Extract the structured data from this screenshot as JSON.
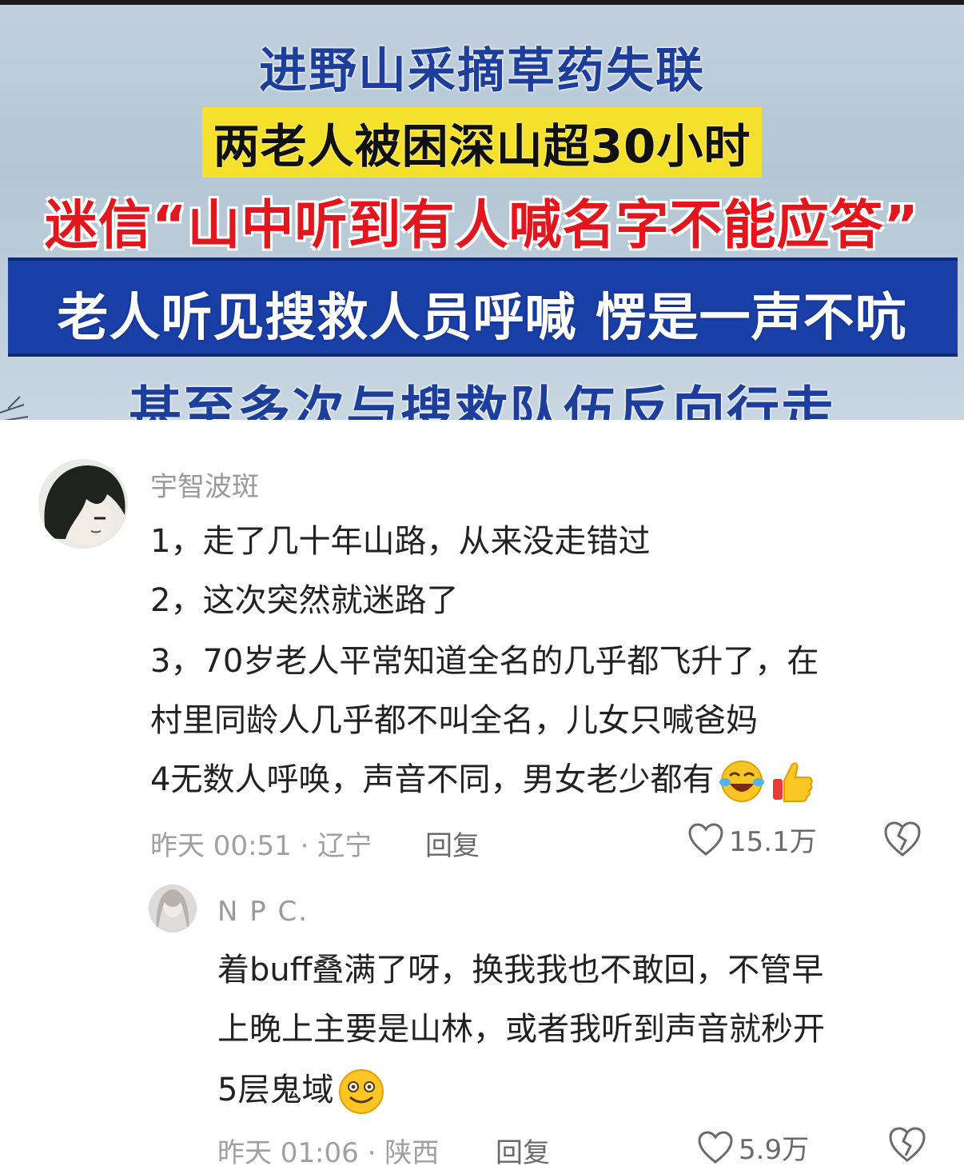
{
  "banner": {
    "line1": "进野山采摘草药失联",
    "line2": "两老人被困深山超30小时",
    "line3": "迷信“山中听到有人喊名字不能应答”",
    "line4": "老人听见搜救人员呼喊 愣是一声不吭",
    "line5": "甚至多次与搜救队伍反向行走"
  },
  "comment": {
    "username": "宇智波斑",
    "lines": [
      "1，走了几十年山路，从来没走错过",
      "2，这次突然就迷路了",
      "3，70岁老人平常知道全名的几乎都飞升了，在",
      "村里同龄人几乎都不叫全名，儿女只喊爸妈",
      "4无数人呼唤，声音不同，男女老少都有"
    ],
    "time_location": "昨天 00:51 · 辽宁",
    "reply_label": "回复",
    "likes": "15.1万"
  },
  "reply": {
    "username": "N P C.",
    "lines": [
      "着buff叠满了呀，换我我也不敢回，不管早",
      "上晚上主要是山林，或者我听到声音就秒开",
      "5层鬼域"
    ],
    "time_location": "昨天 01:06 · 陕西",
    "reply_label": "回复",
    "likes": "5.9万"
  },
  "colors": {
    "banner_blue": "#1d3e9a",
    "banner_red": "#e3161d",
    "banner_yellow": "#f5e12c",
    "bar_blue": "#1a3fa6"
  }
}
